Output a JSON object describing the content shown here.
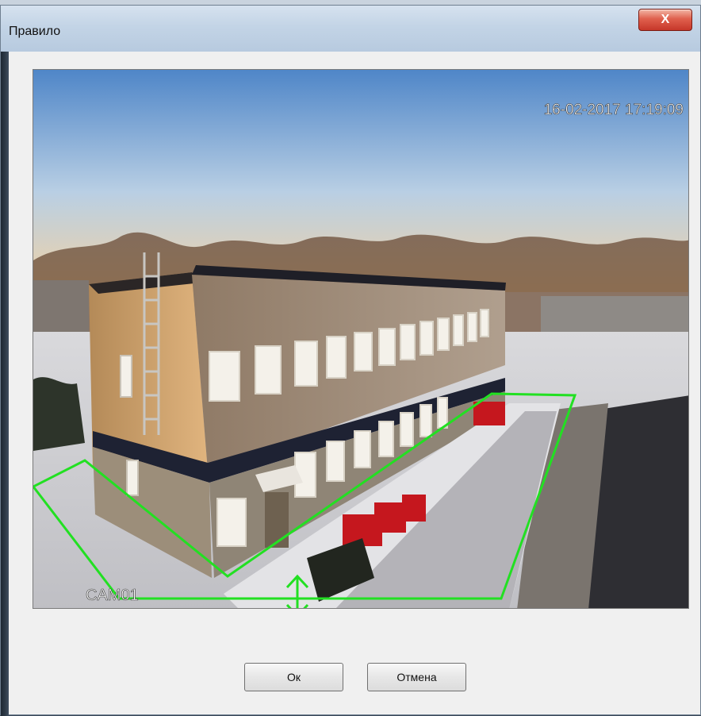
{
  "window": {
    "title": "Правило",
    "close_symbol": "X"
  },
  "camera": {
    "timestamp": "16-02-2017 17:19:09",
    "name": "CAM01",
    "rule_color": "#22e022"
  },
  "buttons": {
    "ok": "Ок",
    "cancel": "Отмена"
  },
  "icons": {
    "direction_arrow": "double-arrow-vertical-icon"
  }
}
